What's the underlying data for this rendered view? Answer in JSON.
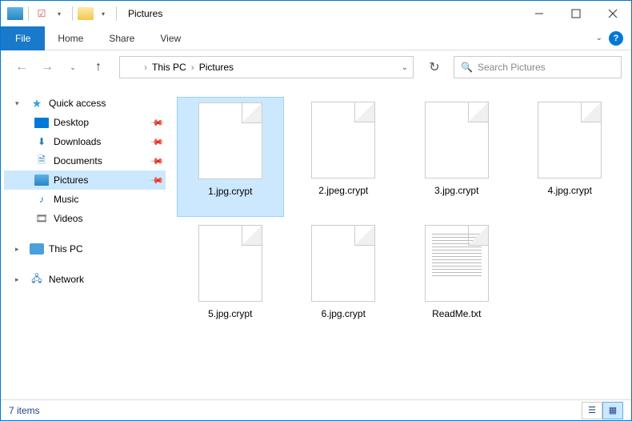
{
  "title": "Pictures",
  "ribbon": {
    "file": "File",
    "tabs": [
      "Home",
      "Share",
      "View"
    ]
  },
  "nav": {
    "breadcrumb": [
      "This PC",
      "Pictures"
    ],
    "search_placeholder": "Search Pictures"
  },
  "sidebar": {
    "quick_access": "Quick access",
    "items": [
      {
        "label": "Desktop",
        "pinned": true
      },
      {
        "label": "Downloads",
        "pinned": true
      },
      {
        "label": "Documents",
        "pinned": true
      },
      {
        "label": "Pictures",
        "pinned": true,
        "selected": true
      },
      {
        "label": "Music",
        "pinned": false
      },
      {
        "label": "Videos",
        "pinned": false
      }
    ],
    "this_pc": "This PC",
    "network": "Network"
  },
  "files": [
    {
      "name": "1.jpg.crypt",
      "type": "blank",
      "selected": true
    },
    {
      "name": "2.jpeg.crypt",
      "type": "blank"
    },
    {
      "name": "3.jpg.crypt",
      "type": "blank"
    },
    {
      "name": "4.jpg.crypt",
      "type": "blank"
    },
    {
      "name": "5.jpg.crypt",
      "type": "blank"
    },
    {
      "name": "6.jpg.crypt",
      "type": "blank"
    },
    {
      "name": "ReadMe.txt",
      "type": "txt"
    }
  ],
  "status": "7 items"
}
